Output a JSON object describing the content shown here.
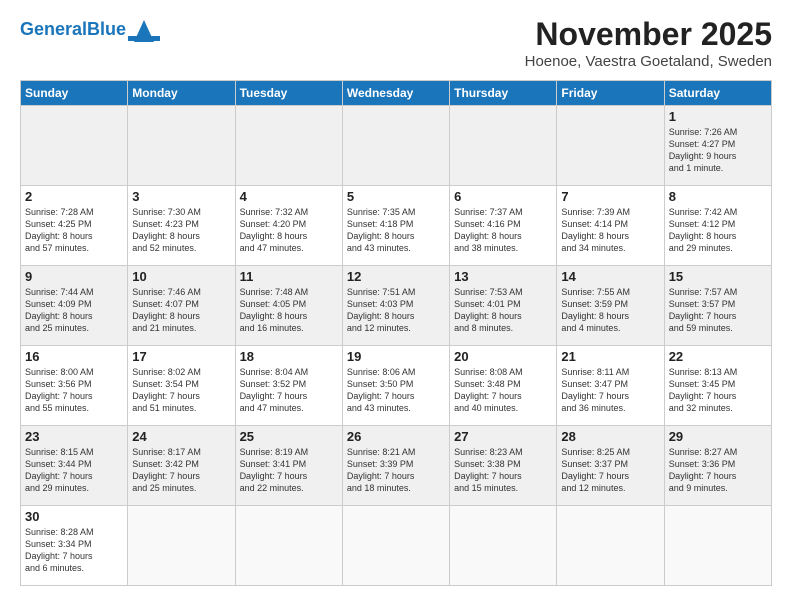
{
  "logo": {
    "text_general": "General",
    "text_blue": "Blue"
  },
  "header": {
    "month": "November 2025",
    "location": "Hoenoe, Vaestra Goetaland, Sweden"
  },
  "days_of_week": [
    "Sunday",
    "Monday",
    "Tuesday",
    "Wednesday",
    "Thursday",
    "Friday",
    "Saturday"
  ],
  "weeks": [
    [
      {
        "day": "",
        "info": ""
      },
      {
        "day": "",
        "info": ""
      },
      {
        "day": "",
        "info": ""
      },
      {
        "day": "",
        "info": ""
      },
      {
        "day": "",
        "info": ""
      },
      {
        "day": "",
        "info": ""
      },
      {
        "day": "1",
        "info": "Sunrise: 7:26 AM\nSunset: 4:27 PM\nDaylight: 9 hours\nand 1 minute."
      }
    ],
    [
      {
        "day": "2",
        "info": "Sunrise: 7:28 AM\nSunset: 4:25 PM\nDaylight: 8 hours\nand 57 minutes."
      },
      {
        "day": "3",
        "info": "Sunrise: 7:30 AM\nSunset: 4:23 PM\nDaylight: 8 hours\nand 52 minutes."
      },
      {
        "day": "4",
        "info": "Sunrise: 7:32 AM\nSunset: 4:20 PM\nDaylight: 8 hours\nand 47 minutes."
      },
      {
        "day": "5",
        "info": "Sunrise: 7:35 AM\nSunset: 4:18 PM\nDaylight: 8 hours\nand 43 minutes."
      },
      {
        "day": "6",
        "info": "Sunrise: 7:37 AM\nSunset: 4:16 PM\nDaylight: 8 hours\nand 38 minutes."
      },
      {
        "day": "7",
        "info": "Sunrise: 7:39 AM\nSunset: 4:14 PM\nDaylight: 8 hours\nand 34 minutes."
      },
      {
        "day": "8",
        "info": "Sunrise: 7:42 AM\nSunset: 4:12 PM\nDaylight: 8 hours\nand 29 minutes."
      }
    ],
    [
      {
        "day": "9",
        "info": "Sunrise: 7:44 AM\nSunset: 4:09 PM\nDaylight: 8 hours\nand 25 minutes."
      },
      {
        "day": "10",
        "info": "Sunrise: 7:46 AM\nSunset: 4:07 PM\nDaylight: 8 hours\nand 21 minutes."
      },
      {
        "day": "11",
        "info": "Sunrise: 7:48 AM\nSunset: 4:05 PM\nDaylight: 8 hours\nand 16 minutes."
      },
      {
        "day": "12",
        "info": "Sunrise: 7:51 AM\nSunset: 4:03 PM\nDaylight: 8 hours\nand 12 minutes."
      },
      {
        "day": "13",
        "info": "Sunrise: 7:53 AM\nSunset: 4:01 PM\nDaylight: 8 hours\nand 8 minutes."
      },
      {
        "day": "14",
        "info": "Sunrise: 7:55 AM\nSunset: 3:59 PM\nDaylight: 8 hours\nand 4 minutes."
      },
      {
        "day": "15",
        "info": "Sunrise: 7:57 AM\nSunset: 3:57 PM\nDaylight: 7 hours\nand 59 minutes."
      }
    ],
    [
      {
        "day": "16",
        "info": "Sunrise: 8:00 AM\nSunset: 3:56 PM\nDaylight: 7 hours\nand 55 minutes."
      },
      {
        "day": "17",
        "info": "Sunrise: 8:02 AM\nSunset: 3:54 PM\nDaylight: 7 hours\nand 51 minutes."
      },
      {
        "day": "18",
        "info": "Sunrise: 8:04 AM\nSunset: 3:52 PM\nDaylight: 7 hours\nand 47 minutes."
      },
      {
        "day": "19",
        "info": "Sunrise: 8:06 AM\nSunset: 3:50 PM\nDaylight: 7 hours\nand 43 minutes."
      },
      {
        "day": "20",
        "info": "Sunrise: 8:08 AM\nSunset: 3:48 PM\nDaylight: 7 hours\nand 40 minutes."
      },
      {
        "day": "21",
        "info": "Sunrise: 8:11 AM\nSunset: 3:47 PM\nDaylight: 7 hours\nand 36 minutes."
      },
      {
        "day": "22",
        "info": "Sunrise: 8:13 AM\nSunset: 3:45 PM\nDaylight: 7 hours\nand 32 minutes."
      }
    ],
    [
      {
        "day": "23",
        "info": "Sunrise: 8:15 AM\nSunset: 3:44 PM\nDaylight: 7 hours\nand 29 minutes."
      },
      {
        "day": "24",
        "info": "Sunrise: 8:17 AM\nSunset: 3:42 PM\nDaylight: 7 hours\nand 25 minutes."
      },
      {
        "day": "25",
        "info": "Sunrise: 8:19 AM\nSunset: 3:41 PM\nDaylight: 7 hours\nand 22 minutes."
      },
      {
        "day": "26",
        "info": "Sunrise: 8:21 AM\nSunset: 3:39 PM\nDaylight: 7 hours\nand 18 minutes."
      },
      {
        "day": "27",
        "info": "Sunrise: 8:23 AM\nSunset: 3:38 PM\nDaylight: 7 hours\nand 15 minutes."
      },
      {
        "day": "28",
        "info": "Sunrise: 8:25 AM\nSunset: 3:37 PM\nDaylight: 7 hours\nand 12 minutes."
      },
      {
        "day": "29",
        "info": "Sunrise: 8:27 AM\nSunset: 3:36 PM\nDaylight: 7 hours\nand 9 minutes."
      }
    ],
    [
      {
        "day": "30",
        "info": "Sunrise: 8:28 AM\nSunset: 3:34 PM\nDaylight: 7 hours\nand 6 minutes."
      },
      {
        "day": "",
        "info": ""
      },
      {
        "day": "",
        "info": ""
      },
      {
        "day": "",
        "info": ""
      },
      {
        "day": "",
        "info": ""
      },
      {
        "day": "",
        "info": ""
      },
      {
        "day": "",
        "info": ""
      }
    ]
  ]
}
